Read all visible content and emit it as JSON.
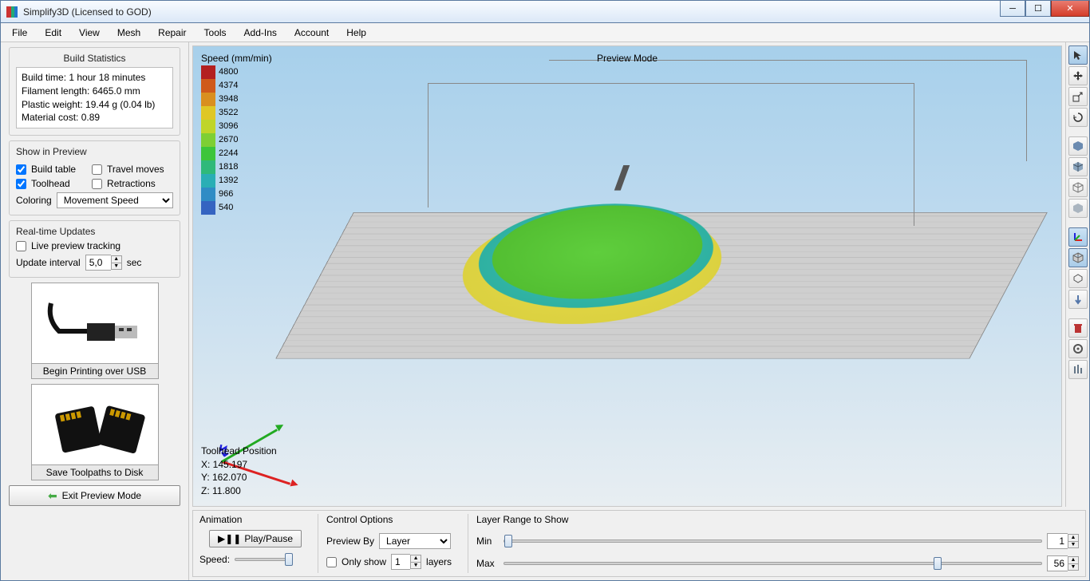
{
  "window": {
    "title": "Simplify3D (Licensed to GOD)"
  },
  "menu": [
    "File",
    "Edit",
    "View",
    "Mesh",
    "Repair",
    "Tools",
    "Add-Ins",
    "Account",
    "Help"
  ],
  "stats": {
    "title": "Build Statistics",
    "build_time": "Build time: 1 hour 18 minutes",
    "filament": "Filament length: 6465.0 mm",
    "weight": "Plastic weight: 19.44 g (0.04 lb)",
    "cost": "Material cost: 0.89"
  },
  "show_in_preview": {
    "title": "Show in Preview",
    "build_table": "Build table",
    "toolhead": "Toolhead",
    "travel": "Travel moves",
    "retractions": "Retractions",
    "coloring_label": "Coloring",
    "coloring_value": "Movement Speed"
  },
  "realtime": {
    "title": "Real-time Updates",
    "live_tracking": "Live preview tracking",
    "interval_label": "Update interval",
    "interval_value": "5,0",
    "interval_unit": "sec"
  },
  "usb_btn": "Begin Printing over USB",
  "disk_btn": "Save Toolpaths to Disk",
  "exit_btn": "Exit Preview Mode",
  "viewport": {
    "legend_title": "Speed (mm/min)",
    "legend_values": [
      "4800",
      "4374",
      "3948",
      "3522",
      "3096",
      "2670",
      "2244",
      "1818",
      "1392",
      "966",
      "540"
    ],
    "legend_colors": [
      "#b32020",
      "#cf5a1b",
      "#d98f1f",
      "#dfc726",
      "#bfd52a",
      "#7ecf34",
      "#3dc53b",
      "#2fb97a",
      "#2aaeb5",
      "#2f8cc5",
      "#3564c1"
    ],
    "preview_mode": "Preview Mode",
    "toolhead_title": "Toolhead Position",
    "tx": "X: 145.197",
    "ty": "Y: 162.070",
    "tz": "Z: 11.800"
  },
  "bottom": {
    "animation": "Animation",
    "play": "Play/Pause",
    "speed": "Speed:",
    "control": "Control Options",
    "preview_by": "Preview By",
    "preview_by_value": "Layer",
    "only_show": "Only show",
    "only_show_value": "1",
    "only_show_unit": "layers",
    "range": "Layer Range to Show",
    "min": "Min",
    "min_value": "1",
    "max": "Max",
    "max_value": "56"
  },
  "right_tools": [
    "select",
    "move",
    "scale",
    "rotate",
    "cube-solid",
    "cube-shaded",
    "cube-wire",
    "cube-bottom",
    "axes",
    "box-view",
    "extrude",
    "axis-down",
    "delete",
    "gear",
    "support"
  ]
}
